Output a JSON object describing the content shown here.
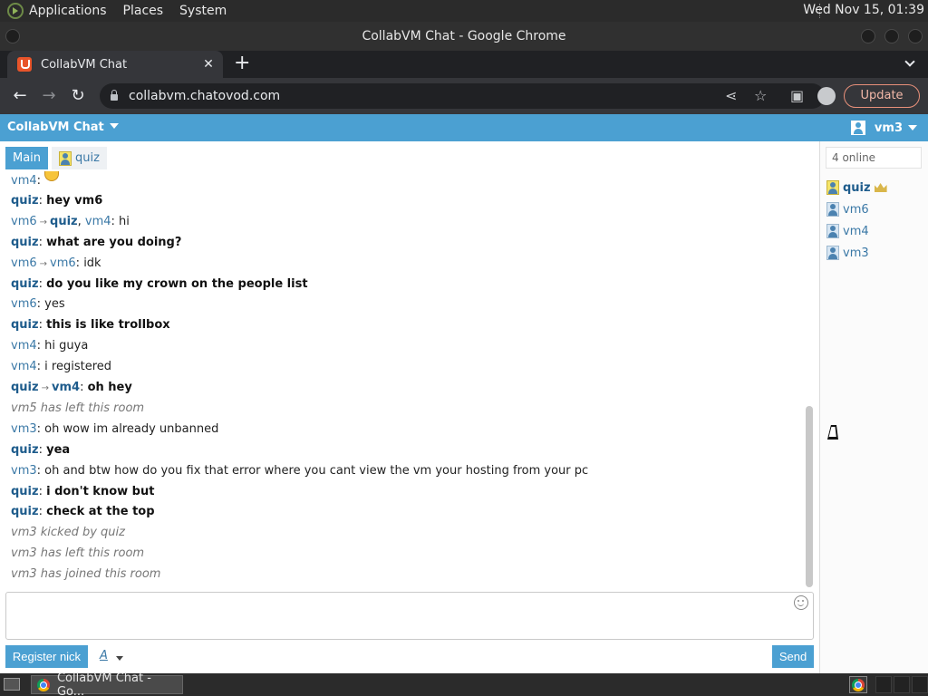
{
  "system": {
    "menus": [
      "Applications",
      "Places",
      "System"
    ],
    "clock": "Wed Nov 15, 01:39"
  },
  "window": {
    "title": "CollabVM Chat - Google Chrome"
  },
  "browser": {
    "tab_title": "CollabVM Chat",
    "url": "collabvm.chatovod.com",
    "update_label": "Update"
  },
  "app": {
    "brand": "CollabVM Chat",
    "current_user": "vm3",
    "rooms": [
      {
        "label": "Main"
      },
      {
        "label": "quiz"
      }
    ],
    "online_count": "4 online",
    "online_users": [
      "quiz",
      "vm6",
      "vm4",
      "vm3"
    ],
    "input_placeholder": "",
    "register_label": "Register nick",
    "font_label": "A",
    "send_label": "Send"
  },
  "messages": [
    {
      "kind": "normal",
      "from": "vm4",
      "text": ""
    },
    {
      "kind": "admin",
      "from": "quiz",
      "text": "hey vm6"
    },
    {
      "kind": "normal",
      "from": "vm6",
      "to": "quiz",
      "extra": "vm4",
      "text": "hi"
    },
    {
      "kind": "admin",
      "from": "quiz",
      "text": "what are you doing?"
    },
    {
      "kind": "normal",
      "from": "vm6",
      "to": "vm6",
      "text": "idk"
    },
    {
      "kind": "admin",
      "from": "quiz",
      "text": "do you like my crown on the people list"
    },
    {
      "kind": "normal",
      "from": "vm6",
      "text": "yes"
    },
    {
      "kind": "admin",
      "from": "quiz",
      "text": "this is like trollbox"
    },
    {
      "kind": "normal",
      "from": "vm4",
      "text": "hi guya"
    },
    {
      "kind": "normal",
      "from": "vm4",
      "text": "i registered"
    },
    {
      "kind": "admin",
      "from": "quiz",
      "to": "vm4",
      "text": "oh hey"
    },
    {
      "kind": "system",
      "text": "vm5 has left this room"
    },
    {
      "kind": "normal",
      "from": "vm3",
      "text": "oh wow im already unbanned"
    },
    {
      "kind": "admin",
      "from": "quiz",
      "text": "yea"
    },
    {
      "kind": "normal",
      "from": "vm3",
      "text": "oh and btw how do you fix that error where you cant view the vm your hosting from your pc"
    },
    {
      "kind": "admin",
      "from": "quiz",
      "text": "i don't know but"
    },
    {
      "kind": "admin",
      "from": "quiz",
      "text": "check at the top"
    },
    {
      "kind": "system",
      "text": "vm3 kicked by quiz"
    },
    {
      "kind": "system",
      "text": "vm3 has left this room"
    },
    {
      "kind": "system",
      "text": "vm3 has joined this room"
    }
  ],
  "taskbar": {
    "item": "CollabVM Chat - Go..."
  }
}
